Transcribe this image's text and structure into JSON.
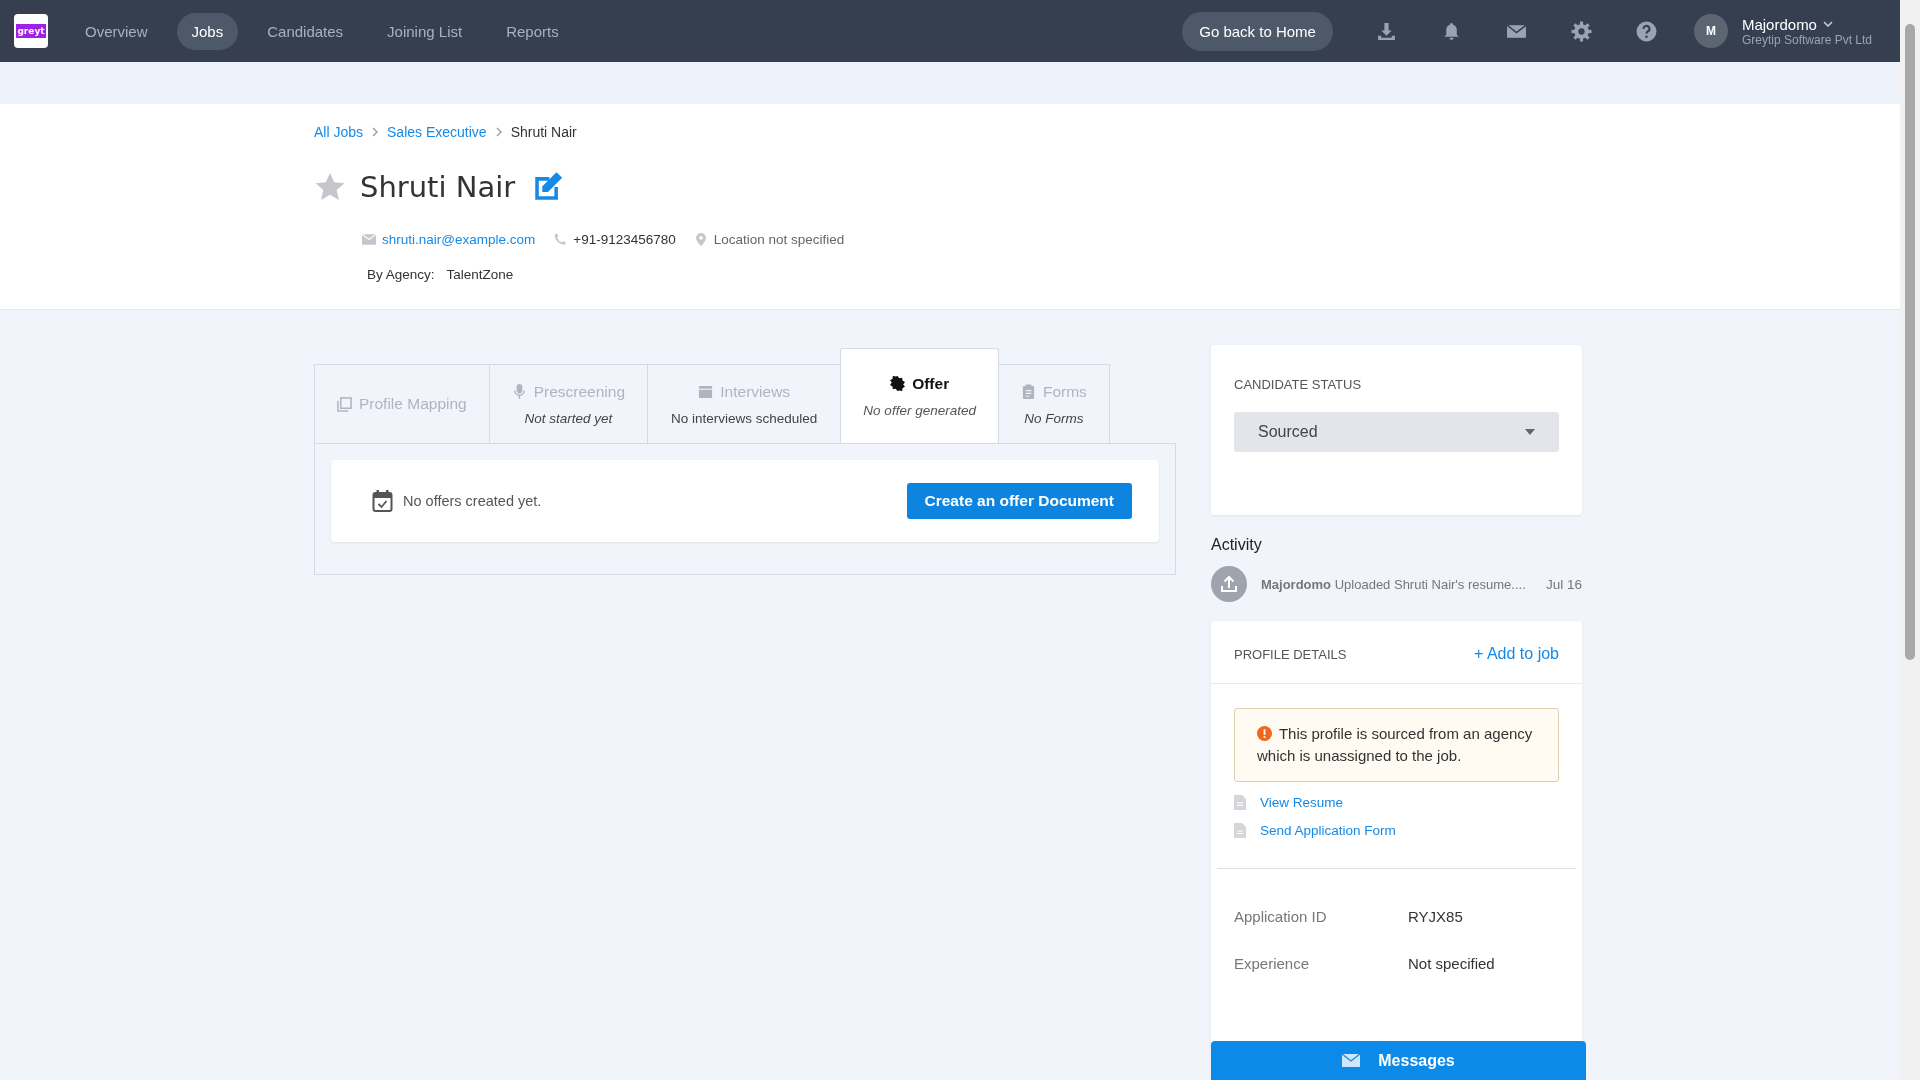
{
  "nav": {
    "logo": "greyt",
    "items": [
      {
        "label": "Overview",
        "selected": false
      },
      {
        "label": "Jobs",
        "selected": true
      },
      {
        "label": "Candidates",
        "selected": false
      },
      {
        "label": "Joining List",
        "selected": false
      },
      {
        "label": "Reports",
        "selected": false
      }
    ],
    "home_button": "Go back to Home",
    "user": {
      "initial": "M",
      "name": "Majordomo",
      "company": "Greytip Software Pvt Ltd"
    }
  },
  "breadcrumb": [
    {
      "label": "All Jobs",
      "link": true
    },
    {
      "label": "Sales Executive",
      "link": true
    },
    {
      "label": "Shruti Nair",
      "link": false
    }
  ],
  "candidate": {
    "name": "Shruti Nair",
    "starred": false,
    "email": "shruti.nair@example.com",
    "phone": "+91-9123456780",
    "location": "Location not specified",
    "agency_label": "By Agency:",
    "agency": "TalentZone"
  },
  "tabs": [
    {
      "label": "Profile Mapping",
      "selected": false
    },
    {
      "label": "Prescreening",
      "sub": "Not started yet",
      "sub_italic": true,
      "selected": false
    },
    {
      "label": "Interviews",
      "sub": "No interviews scheduled",
      "sub_italic": false,
      "selected": false
    },
    {
      "label": "Offer",
      "sub": "No offer generated",
      "sub_italic": true,
      "selected": true
    },
    {
      "label": "Forms",
      "sub": "No Forms",
      "sub_italic": true,
      "selected": false
    }
  ],
  "offer_panel": {
    "message": "No offers created yet.",
    "button": "Create an offer Document"
  },
  "status_card": {
    "title": "CANDIDATE STATUS",
    "value": "Sourced"
  },
  "activity": {
    "title": "Activity",
    "items": [
      {
        "user": "Majordomo",
        "text": "Uploaded Shruti Nair's resume....",
        "date": "Jul 16"
      }
    ]
  },
  "profile": {
    "title": "PROFILE DETAILS",
    "add_link": "+ Add to job",
    "warning": "This profile is sourced from an agency which is unassigned to the job.",
    "links": [
      "View Resume",
      "Send Application Form"
    ],
    "fields": [
      {
        "label": "Application ID",
        "value": "RYJX85"
      },
      {
        "label": "Experience",
        "value": "Not specified"
      }
    ]
  },
  "messages_button": "Messages"
}
